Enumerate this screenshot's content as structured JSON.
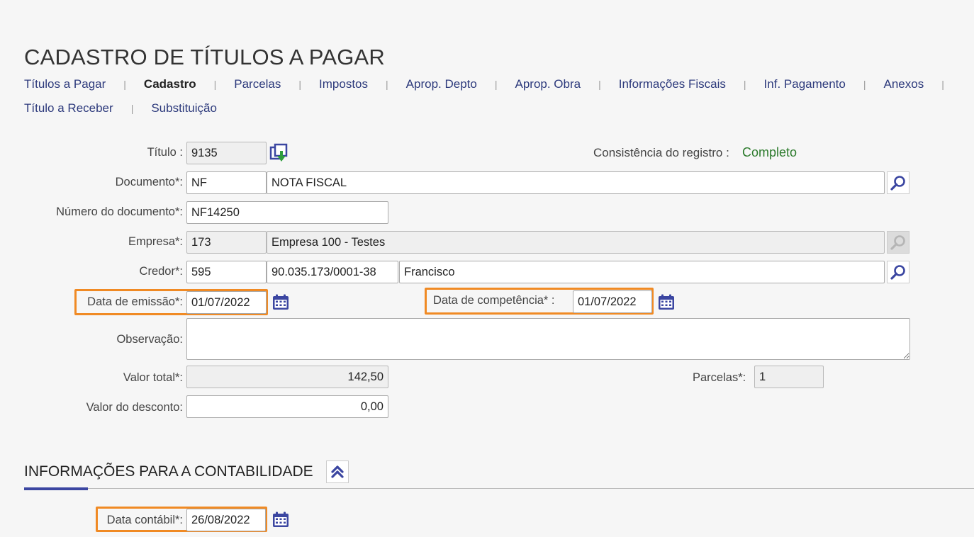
{
  "page": {
    "title": "CADASTRO DE TÍTULOS A PAGAR"
  },
  "tabs": {
    "row1": [
      "Títulos a Pagar",
      "Cadastro",
      "Parcelas",
      "Impostos",
      "Aprop. Depto",
      "Aprop. Obra",
      "Informações Fiscais",
      "Inf. Pagamento",
      "Anexos"
    ],
    "row2": [
      "Título a Receber",
      "Substituição"
    ],
    "active": "Cadastro"
  },
  "form": {
    "titulo": {
      "label": "Título :",
      "value": "9135"
    },
    "consistencia": {
      "label": "Consistência do registro",
      "separator": ":",
      "value": "Completo"
    },
    "documento": {
      "label": "Documento*:",
      "code": "NF",
      "description": "NOTA FISCAL"
    },
    "numero_documento": {
      "label": "Número do documento*:",
      "value": "NF14250"
    },
    "empresa": {
      "label": "Empresa*:",
      "code": "173",
      "name": "Empresa 100 - Testes"
    },
    "credor": {
      "label": "Credor*:",
      "code": "595",
      "cnpj": "90.035.173/0001-38",
      "name": "Francisco"
    },
    "data_emissao": {
      "label": "Data de emissão*:",
      "value": "01/07/2022"
    },
    "data_competencia": {
      "label": "Data de competência* :",
      "value": "01/07/2022"
    },
    "observacao": {
      "label": "Observação:",
      "value": ""
    },
    "valor_total": {
      "label": "Valor total*:",
      "value": "142,50"
    },
    "parcelas": {
      "label": "Parcelas*:",
      "value": "1"
    },
    "valor_desconto": {
      "label": "Valor do desconto:",
      "value": "0,00"
    }
  },
  "contabilidade": {
    "title": "INFORMAÇÕES PARA A CONTABILIDADE",
    "data_contabil": {
      "label": "Data contábil*:",
      "value": "26/08/2022"
    }
  },
  "colors": {
    "accent": "#f08a24",
    "link": "#2d3a7c",
    "status_ok": "#2b7a2b",
    "icon": "#3b46a1"
  }
}
